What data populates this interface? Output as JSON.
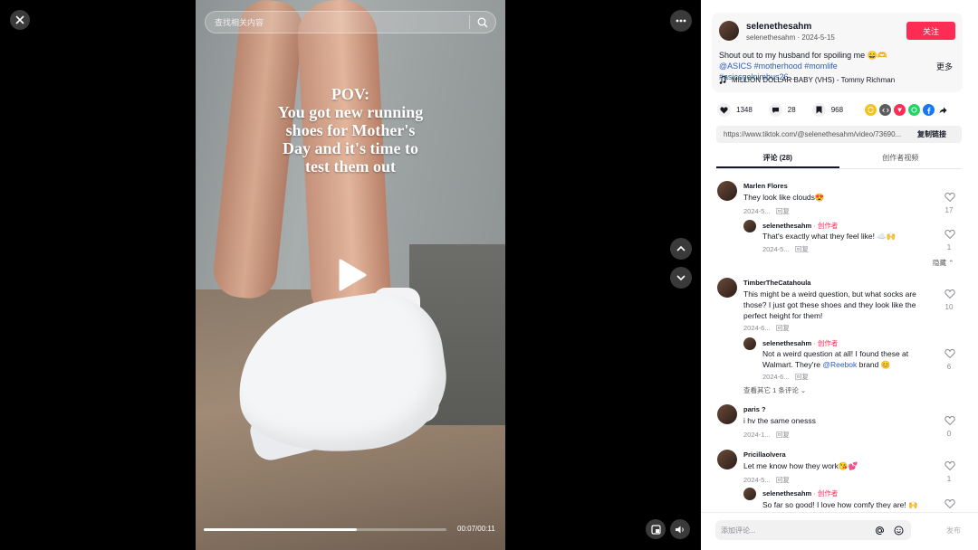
{
  "video": {
    "search_placeholder": "查找相关内容",
    "overlay_lines": [
      "POV:",
      "You got new running",
      "shoes for Mother's",
      "Day and it's time to",
      "test them out"
    ],
    "time": "00:07/00:11",
    "progress": 0.63
  },
  "author": {
    "name": "selenethesahm",
    "sub": "selenethesahm · 2024-5-15",
    "follow_label": "关注",
    "caption_text": "Shout out to my husband for spoiling me 😄🫶",
    "caption_mention": "@ASICS",
    "caption_tags": "#motherhood #momlife #asicsgelnimbus26...",
    "more_label": "更多",
    "music": "MILLION DOLLAR BABY (VHS) - Tommy Richman"
  },
  "stats": {
    "likes": "1348",
    "comments": "28",
    "saves": "968"
  },
  "share": {
    "link": "https://www.tiktok.com/@selenethesahm/video/73690...",
    "copy_label": "复制链接"
  },
  "tabs": {
    "comments": "评论 (28)",
    "creator_videos": "创作者视频"
  },
  "comments": [
    {
      "name": "Marlen Flores",
      "text": "They look like clouds😍",
      "date": "2024-5...",
      "reply": "回复",
      "likes": "17"
    },
    {
      "name": "selenethesahm",
      "creator": " · 创作者",
      "text": "That's exactly what they feel like! ☁️🙌",
      "date": "2024-5...",
      "reply": "回复",
      "likes": "1",
      "hide": "隐藏 ⌃"
    },
    {
      "name": "TimberTheCatahoula",
      "text": "This might be a weird question, but what socks are those? I just got these shoes and they look like the perfect height for them!",
      "date": "2024-6...",
      "reply": "回复",
      "likes": "10"
    },
    {
      "name": "selenethesahm",
      "creator": " · 创作者",
      "text_before": "Not a weird question at all! I found these at Walmart. They're ",
      "mention": "@Reebok",
      "text_after": " brand 😊",
      "date": "2024-6...",
      "reply": "回复",
      "likes": "6",
      "view_more": "查看其它 1 条评论 ⌄"
    },
    {
      "name": "paris ?",
      "text": "i hv the same onesss",
      "date": "2024-1...",
      "reply": "回复",
      "likes": "0"
    },
    {
      "name": "Pricillaolvera",
      "text": "Let me know how they work😘💕",
      "date": "2024-5...",
      "reply": "回复",
      "likes": "1"
    },
    {
      "name": "selenethesahm",
      "creator": " · 创作者",
      "text": "So far so good! I love how comfy they are! 🙌"
    }
  ],
  "footer": {
    "placeholder": "添加评论...",
    "post_label": "发布"
  }
}
